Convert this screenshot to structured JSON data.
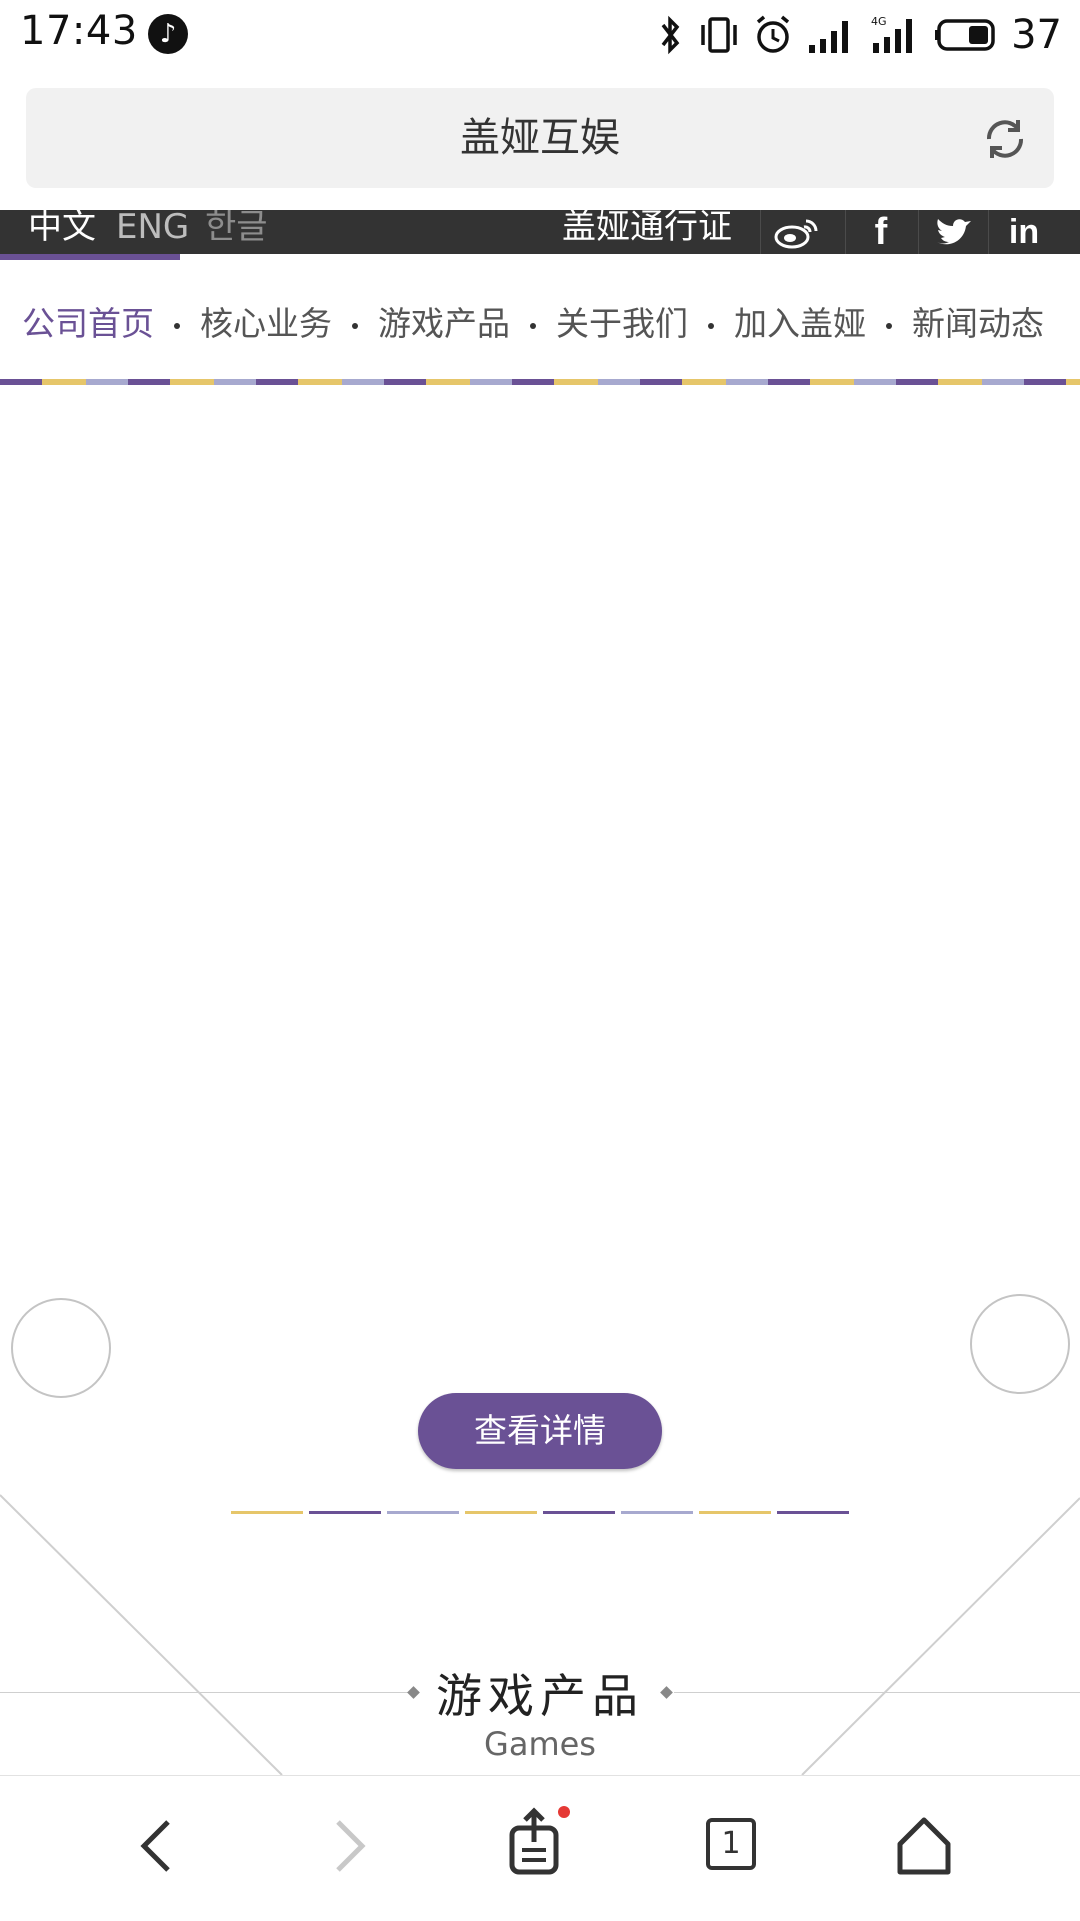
{
  "status_bar": {
    "time": "17:43",
    "battery": "37",
    "icons": [
      "bluetooth-icon",
      "vibrate-icon",
      "alarm-icon",
      "signal-icon",
      "4g-signal-icon",
      "battery-icon"
    ]
  },
  "address_bar": {
    "title": "盖娅互娱"
  },
  "site_bar": {
    "lang_zh": "中文",
    "lang_en": "ENG",
    "lang_ko": "한글",
    "passport": "盖娅通行证",
    "social": [
      "weibo-icon",
      "facebook-icon",
      "twitter-icon",
      "linkedin-icon"
    ]
  },
  "nav": {
    "items": [
      {
        "label": "公司首页",
        "active": true
      },
      {
        "label": "核心业务",
        "active": false
      },
      {
        "label": "游戏产品",
        "active": false
      },
      {
        "label": "关于我们",
        "active": false
      },
      {
        "label": "加入盖娅",
        "active": false
      },
      {
        "label": "新闻动态",
        "active": false
      }
    ]
  },
  "banner": {
    "detail_button": "查看详情"
  },
  "section": {
    "title": "游戏产品",
    "subtitle": "Games"
  },
  "bottom_bar": {
    "tab_count": "1"
  },
  "colors": {
    "accent": "#6a5195",
    "yellow": "#e6c66a",
    "lavender": "#a7a9cf",
    "dark_bar": "#333333"
  }
}
